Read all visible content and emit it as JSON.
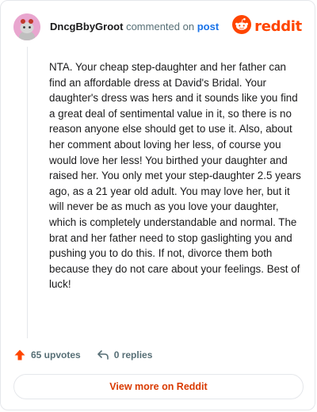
{
  "header": {
    "username": "DncgBbyGroot",
    "commented_text": "commented on",
    "post_link": "post",
    "brand_name": "reddit",
    "brand_color": "#ff4500",
    "avatar_icon": "snoo-avatar-icon",
    "brand_icon": "reddit-logo-icon"
  },
  "comment": {
    "body": "NTA. Your cheap step-daughter and her father can find an affordable dress at David's Bridal. Your daughter's dress was hers and it sounds like you find a great deal of sentimental value in it, so there is no reason anyone else should get to use it. Also, about her comment about loving her less, of course you would love her less! You birthed your daughter and raised her. You only met your step-daughter 2.5 years ago, as a 21 year old adult. You may love her, but it will never be as much as you love your daughter, which is completely understandable and normal. The brat and her father need to stop gaslighting you and pushing you to do this. If not, divorce them both because they do not care about your feelings. Best of luck!"
  },
  "actions": {
    "upvotes": "65 upvotes",
    "upvote_icon": "upvote-arrow-icon",
    "upvote_color": "#ff4500",
    "replies": "0 replies",
    "reply_icon": "reply-arrow-icon"
  },
  "footer": {
    "view_more": "View more on Reddit",
    "accent_color": "#d93a00"
  }
}
